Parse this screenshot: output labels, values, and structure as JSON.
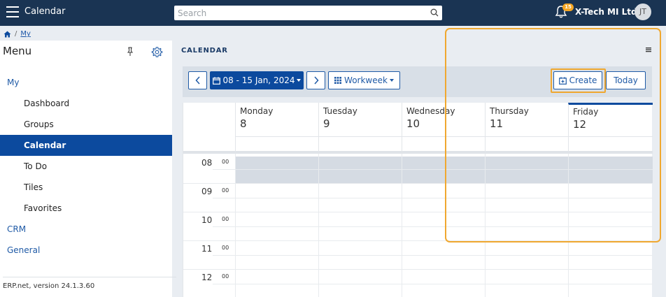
{
  "topbar": {
    "app_title": "Calendar",
    "search_placeholder": "Search",
    "notification_count": "15",
    "company": "X-Tech MI Ltd.",
    "user_initials": "JT"
  },
  "breadcrumb": {
    "current": "My",
    "separator": "/"
  },
  "sidebar": {
    "title": "Menu",
    "items": [
      {
        "label": "My",
        "level": "group",
        "active": false
      },
      {
        "label": "Dashboard",
        "level": "child",
        "active": false
      },
      {
        "label": "Groups",
        "level": "child",
        "active": false
      },
      {
        "label": "Calendar",
        "level": "child",
        "active": true
      },
      {
        "label": "To Do",
        "level": "child",
        "active": false
      },
      {
        "label": "Tiles",
        "level": "child",
        "active": false
      },
      {
        "label": "Favorites",
        "level": "child",
        "active": false
      },
      {
        "label": "CRM",
        "level": "group",
        "active": false
      },
      {
        "label": "General",
        "level": "group",
        "active": false
      }
    ],
    "version": "ERP.net, version 24.1.3.60"
  },
  "main": {
    "title": "CALENDAR",
    "toolbar": {
      "date_range": "08 - 15 Jan, 2024",
      "view": "Workweek",
      "create_label": "Create",
      "today_label": "Today"
    },
    "days": [
      {
        "name": "Monday",
        "num": "8",
        "today": false
      },
      {
        "name": "Tuesday",
        "num": "9",
        "today": false
      },
      {
        "name": "Wednesday",
        "num": "10",
        "today": false
      },
      {
        "name": "Thursday",
        "num": "11",
        "today": false
      },
      {
        "name": "Friday",
        "num": "12",
        "today": true
      }
    ],
    "hours": [
      {
        "hour": "08",
        "min": "00"
      },
      {
        "hour": "09",
        "min": "00"
      },
      {
        "hour": "10",
        "min": "00"
      },
      {
        "hour": "11",
        "min": "00"
      },
      {
        "hour": "12",
        "min": "00"
      }
    ]
  },
  "colors": {
    "topbar": "#1a3453",
    "accent": "#0c4a9e",
    "highlight": "#f0a830",
    "badge": "#f5a623"
  }
}
